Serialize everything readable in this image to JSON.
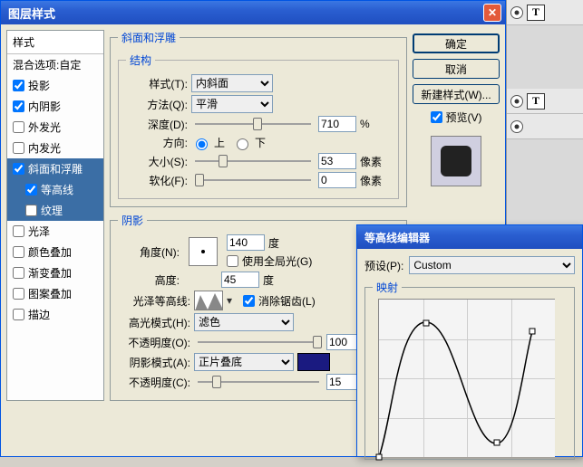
{
  "main_window": {
    "title": "图层样式"
  },
  "styles_panel": {
    "header": "样式",
    "blend_options": "混合选项:自定",
    "items": [
      {
        "label": "投影",
        "checked": true,
        "sub": false,
        "selected": false
      },
      {
        "label": "内阴影",
        "checked": true,
        "sub": false,
        "selected": false
      },
      {
        "label": "外发光",
        "checked": false,
        "sub": false,
        "selected": false
      },
      {
        "label": "内发光",
        "checked": false,
        "sub": false,
        "selected": false
      },
      {
        "label": "斜面和浮雕",
        "checked": true,
        "sub": false,
        "selected": true
      },
      {
        "label": "等高线",
        "checked": true,
        "sub": true,
        "selected": true
      },
      {
        "label": "纹理",
        "checked": false,
        "sub": true,
        "selected": true
      },
      {
        "label": "光泽",
        "checked": false,
        "sub": false,
        "selected": false
      },
      {
        "label": "颜色叠加",
        "checked": false,
        "sub": false,
        "selected": false
      },
      {
        "label": "渐变叠加",
        "checked": false,
        "sub": false,
        "selected": false
      },
      {
        "label": "图案叠加",
        "checked": false,
        "sub": false,
        "selected": false
      },
      {
        "label": "描边",
        "checked": false,
        "sub": false,
        "selected": false
      }
    ]
  },
  "bevel": {
    "group_label": "斜面和浮雕",
    "structure_label": "结构",
    "style": {
      "label": "样式(T):",
      "value": "内斜面"
    },
    "technique": {
      "label": "方法(Q):",
      "value": "平滑"
    },
    "depth": {
      "label": "深度(D):",
      "value": "710",
      "unit": "%",
      "pos": 50
    },
    "direction": {
      "label": "方向:",
      "up": "上",
      "down": "下",
      "selected": "up"
    },
    "size": {
      "label": "大小(S):",
      "value": "53",
      "unit": "像素",
      "pos": 20
    },
    "soften": {
      "label": "软化(F):",
      "value": "0",
      "unit": "像素",
      "pos": 0
    }
  },
  "shading": {
    "group_label": "阴影",
    "angle": {
      "label": "角度(N):",
      "value": "140",
      "unit": "度"
    },
    "global_light": {
      "label": "使用全局光(G)",
      "checked": false
    },
    "altitude": {
      "label": "高度:",
      "value": "45",
      "unit": "度"
    },
    "gloss_contour": {
      "label": "光泽等高线:",
      "anti_alias": {
        "label": "消除锯齿(L)",
        "checked": true
      }
    },
    "highlight": {
      "label": "高光模式(H):",
      "mode": "滤色",
      "opacity_label": "不透明度(O):",
      "opacity": "100",
      "unit": "%",
      "pos": 95
    },
    "shadow": {
      "label": "阴影模式(A):",
      "mode": "正片叠底",
      "color": "#1a1a80",
      "opacity_label": "不透明度(C):",
      "opacity": "15",
      "unit": "%",
      "pos": 12
    }
  },
  "buttons": {
    "ok": "确定",
    "cancel": "取消",
    "new_style": "新建样式(W)...",
    "preview": "预览(V)"
  },
  "layers_strip": {
    "items": [
      {
        "glyph": "T"
      },
      {
        "glyph": "T"
      }
    ]
  },
  "contour_editor": {
    "title": "等高线编辑器",
    "preset_label": "预设(P):",
    "preset_value": "Custom",
    "mapping_label": "映射"
  }
}
